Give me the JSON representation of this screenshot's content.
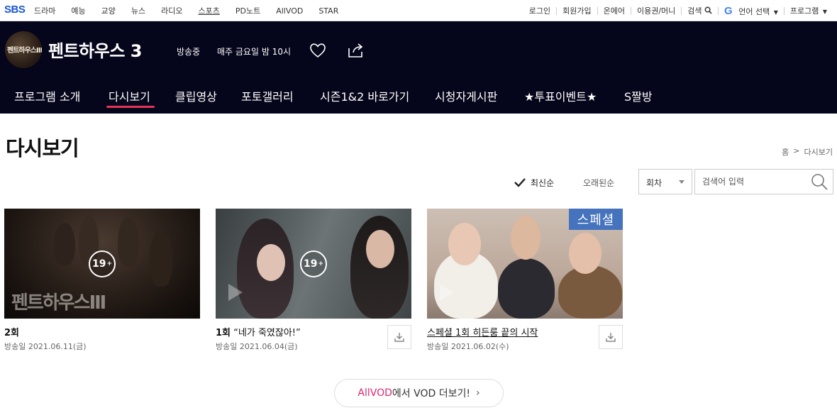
{
  "gnb": {
    "logo": "SBS",
    "nav": [
      "드라마",
      "예능",
      "교양",
      "뉴스",
      "라디오",
      "스포츠",
      "PD노트",
      "AllVOD",
      "STAR"
    ],
    "util": {
      "login": "로그인",
      "signup": "회원가입",
      "onair": "온에어",
      "ticket": "이용권/머니",
      "search": "검색",
      "language": "언어 선택",
      "program": "프로그램"
    }
  },
  "program": {
    "thumb_text": "펜트하우스Ⅲ",
    "title": "펜트하우스 3",
    "status": "방송중",
    "schedule": "매주 금요일 밤 10시",
    "menu": [
      "프로그램 소개",
      "다시보기",
      "클립영상",
      "포토갤러리",
      "시즌1&2 바로가기",
      "시청자게시판",
      "★투표이벤트★",
      "S짤방"
    ],
    "active_menu": "다시보기"
  },
  "page": {
    "title": "다시보기",
    "breadcrumb": {
      "home": "홈",
      "sep": ">",
      "current": "다시보기"
    }
  },
  "controls": {
    "sort_newest": "최신순",
    "sort_oldest": "오래된순",
    "select_value": "회차",
    "search_placeholder": "검색어 입력"
  },
  "episodes": [
    {
      "episode": "2회",
      "subtitle": "",
      "date": "방송일 2021.06.11(금)",
      "rating": "19",
      "has_download": false,
      "badge": "",
      "watermark": "펜트하우스Ⅲ"
    },
    {
      "episode": "1회",
      "subtitle": "“네가 죽였잖아!”",
      "date": "방송일 2021.06.04(금)",
      "rating": "19",
      "has_download": true,
      "badge": "",
      "watermark": ""
    },
    {
      "episode": "스페셜 1회",
      "subtitle": "히든룸 끝의 시작",
      "date": "방송일 2021.06.02(수)",
      "rating": "",
      "has_download": true,
      "badge": "스페셜",
      "watermark": ""
    }
  ],
  "more": {
    "brand": "AllVOD",
    "text": "에서 VOD 더보기!",
    "chevron": "›"
  },
  "colors": {
    "header_bg": "#05051b",
    "accent": "#e8325c",
    "brand_pink": "#e0266f",
    "sbs_blue": "#1a56d6"
  }
}
